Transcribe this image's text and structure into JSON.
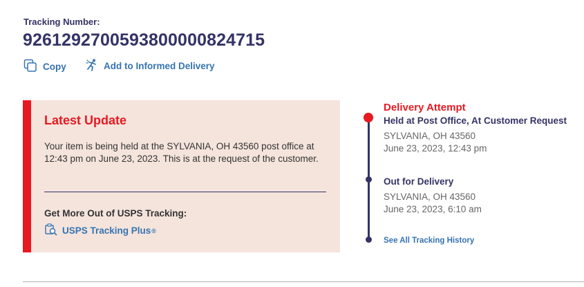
{
  "tracking": {
    "label": "Tracking Number:",
    "number": "9261292700593800000824715",
    "copy_label": "Copy",
    "informed_delivery_label": "Add to Informed Delivery"
  },
  "latest_update": {
    "title": "Latest Update",
    "message": "Your item is being held at the SYLVANIA, OH 43560 post office at 12:43 pm on June 23, 2023. This is at the request of the customer.",
    "more_title": "Get More Out of USPS Tracking:",
    "plus_link_label": "USPS Tracking Plus",
    "plus_link_mark": "®"
  },
  "timeline": {
    "events": [
      {
        "status": "Delivery Attempt",
        "title": "Held at Post Office, At Customer Request",
        "location": "SYLVANIA, OH 43560",
        "datetime": "June 23, 2023, 12:43 pm"
      },
      {
        "title": "Out for Delivery",
        "location": "SYLVANIA, OH 43560",
        "datetime": "June 23, 2023, 6:10 am"
      }
    ],
    "see_all_label": "See All Tracking History"
  },
  "colors": {
    "navy": "#333366",
    "red": "#e71921",
    "link_blue": "#3573b1",
    "card_bg": "#f4e4dc"
  },
  "icons": {
    "copy": "copy-icon",
    "informed_delivery": "running-person-icon",
    "tracking_plus": "tracking-plus-icon"
  }
}
